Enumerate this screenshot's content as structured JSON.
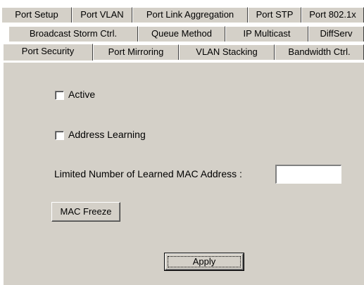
{
  "tabs": {
    "row1": [
      "Port Setup",
      "Port VLAN",
      "Port Link Aggregation",
      "Port STP",
      "Port 802.1x"
    ],
    "row2": [
      "Broadcast Storm Ctrl.",
      "Queue Method",
      "IP Multicast",
      "DiffServ"
    ],
    "row3": [
      "Port Security",
      "Port Mirroring",
      "VLAN Stacking",
      "Bandwidth Ctrl."
    ],
    "active": "Port Security"
  },
  "form": {
    "active_label": "Active",
    "address_learning_label": "Address Learning",
    "limited_mac_label": "Limited Number of Learned MAC Address :",
    "limited_mac_value": "",
    "mac_freeze_label": "MAC Freeze",
    "apply_label": "Apply"
  }
}
